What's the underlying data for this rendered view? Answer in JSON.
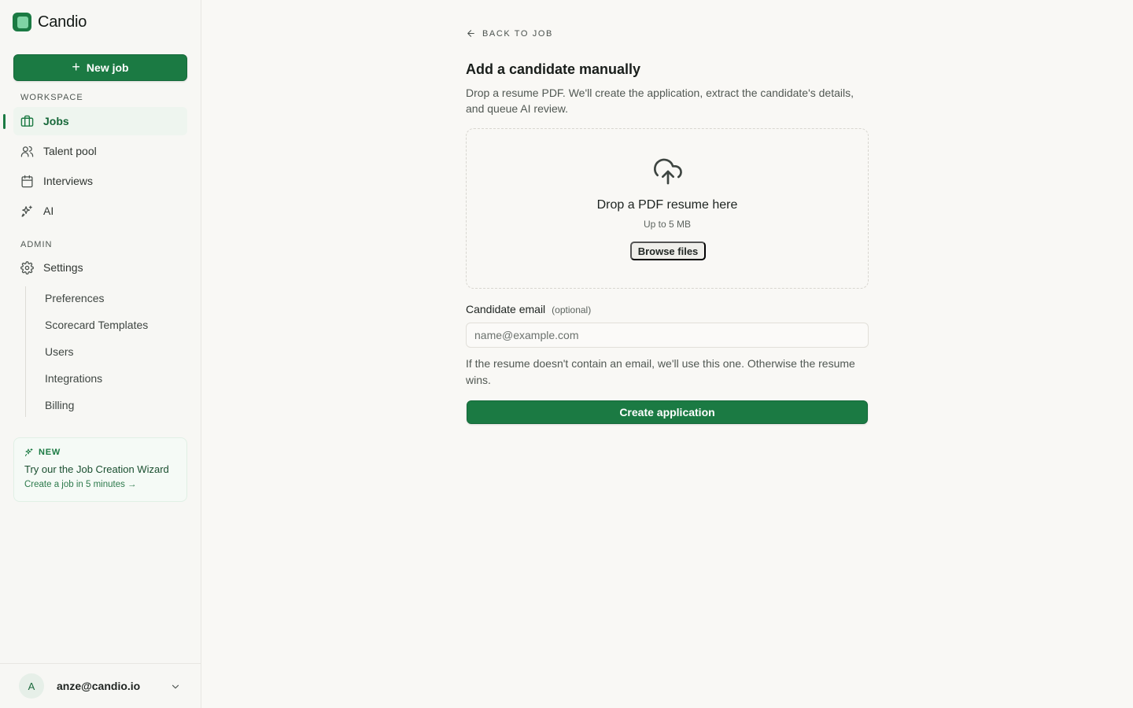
{
  "app": {
    "name": "Candio"
  },
  "sidebar": {
    "new_job_label": "New job",
    "workspace_label": "WORKSPACE",
    "workspace_items": [
      {
        "label": "Jobs",
        "icon": "briefcase-icon",
        "active": true
      },
      {
        "label": "Talent pool",
        "icon": "users-icon"
      },
      {
        "label": "Interviews",
        "icon": "calendar-icon"
      },
      {
        "label": "AI",
        "icon": "sparkles-icon"
      }
    ],
    "admin_label": "ADMIN",
    "settings_label": "Settings",
    "settings_items": [
      {
        "label": "Preferences"
      },
      {
        "label": "Scorecard Templates"
      },
      {
        "label": "Users"
      },
      {
        "label": "Integrations"
      },
      {
        "label": "Billing"
      }
    ],
    "promo": {
      "tag": "NEW",
      "title": "Try our the Job Creation Wizard",
      "link": "Create a job in 5 minutes →"
    },
    "user": {
      "initial": "A",
      "email": "anze@candio.io"
    }
  },
  "main": {
    "back_label": "BACK TO JOB",
    "title": "Add a candidate manually",
    "description": "Drop a resume PDF. We'll create the application, extract the candidate's details, and queue AI review.",
    "dropzone": {
      "title": "Drop a PDF resume here",
      "subtitle": "Up to 5 MB",
      "browse_label": "Browse files"
    },
    "email": {
      "label": "Candidate email",
      "optional": "(optional)",
      "placeholder": "name@example.com",
      "value": "",
      "help": "If the resume doesn't contain an email, we'll use this one. Otherwise the resume wins."
    },
    "submit_label": "Create application"
  },
  "colors": {
    "brand": "#1b7a43",
    "brand_light": "#eef5ef"
  }
}
